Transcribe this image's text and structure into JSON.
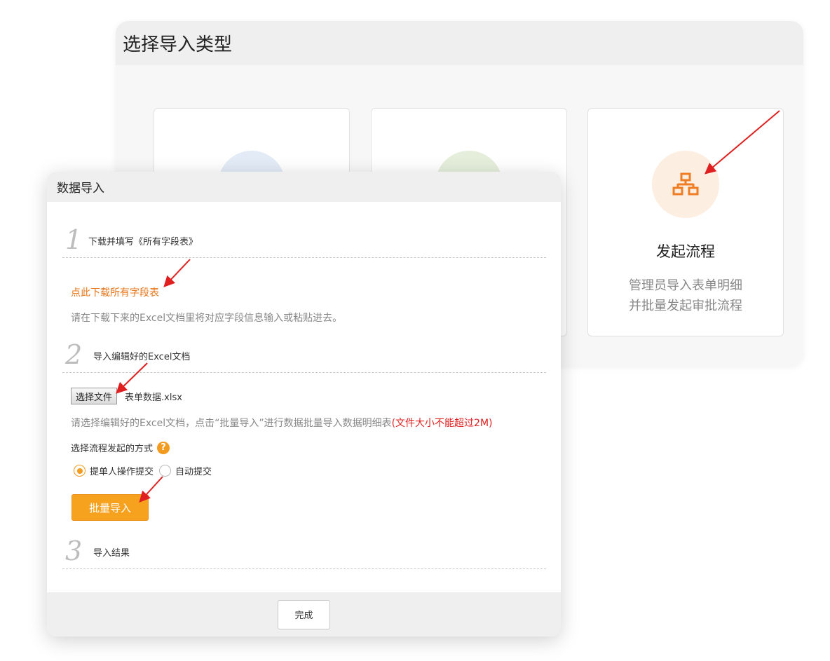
{
  "background_panel": {
    "title": "选择导入类型",
    "cards": [
      {
        "name": "",
        "desc_line1": "",
        "desc_line2": ""
      },
      {
        "name": "",
        "desc_line1": "",
        "desc_line2": ""
      },
      {
        "name": "发起流程",
        "desc_line1": "管理员导入表单明细",
        "desc_line2": "并批量发起审批流程",
        "icon": "org-chart-icon"
      }
    ]
  },
  "dialog": {
    "title": "数据导入",
    "step1": {
      "number": "1",
      "title": "下载并填写《所有字段表》",
      "download_link": "点此下载所有字段表",
      "hint": "请在下载下来的Excel文档里将对应字段信息输入或粘贴进去。"
    },
    "step2": {
      "number": "2",
      "title": "导入编辑好的Excel文档",
      "choose_file_label": "选择文件",
      "file_name": "表单数据.xlsx",
      "hint": "请选择编辑好的Excel文档，点击“批量导入”进行数据批量导入数据明细表",
      "size_warning": "(文件大小不能超过2M)",
      "mode_label": "选择流程发起的方式",
      "help_icon": "?",
      "options": [
        {
          "label": "提单人操作提交",
          "checked": true
        },
        {
          "label": "自动提交",
          "checked": false
        }
      ],
      "batch_button": "批量导入"
    },
    "step3": {
      "number": "3",
      "title": "导入结果"
    },
    "done_button": "完成"
  },
  "colors": {
    "accent_orange": "#f6a21e",
    "link_orange": "#e8761a",
    "warning_red": "#e02020",
    "annotation_arrow": "#e02020"
  }
}
